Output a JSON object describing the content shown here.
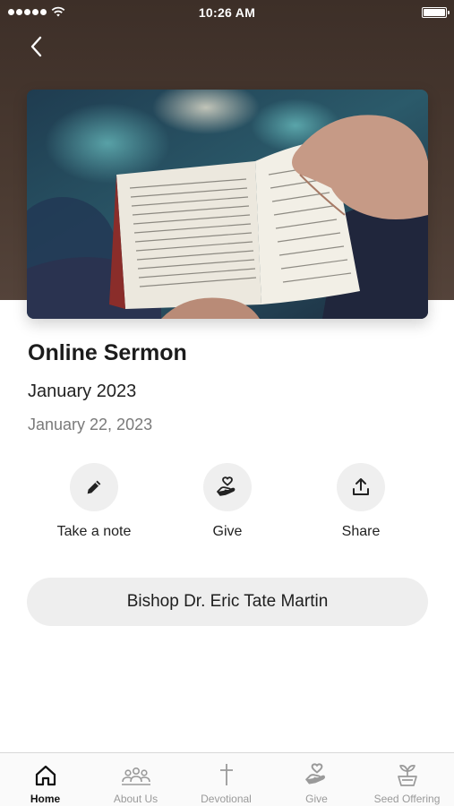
{
  "status_bar": {
    "time": "10:26 AM"
  },
  "header": {
    "back_icon": "chevron-left-icon"
  },
  "sermon": {
    "title": "Online Sermon",
    "series": "January 2023",
    "date": "January 22, 2023",
    "speaker": "Bishop Dr. Eric Tate Martin"
  },
  "actions": [
    {
      "label": "Take a note",
      "icon": "pencil-icon"
    },
    {
      "label": "Give",
      "icon": "heart-hand-icon"
    },
    {
      "label": "Share",
      "icon": "share-icon"
    }
  ],
  "tabs": [
    {
      "label": "Home",
      "icon": "home-icon",
      "active": true
    },
    {
      "label": "About Us",
      "icon": "people-icon",
      "active": false
    },
    {
      "label": "Devotional",
      "icon": "cross-icon",
      "active": false
    },
    {
      "label": "Give",
      "icon": "heart-hand-icon",
      "active": false
    },
    {
      "label": "Seed Offering",
      "icon": "seedling-icon",
      "active": false
    }
  ],
  "colors": {
    "hero_background": "#4a3a31",
    "active_tab": "#111111",
    "inactive_tab": "#9a9a9a",
    "pill_background": "#eeeeee"
  }
}
